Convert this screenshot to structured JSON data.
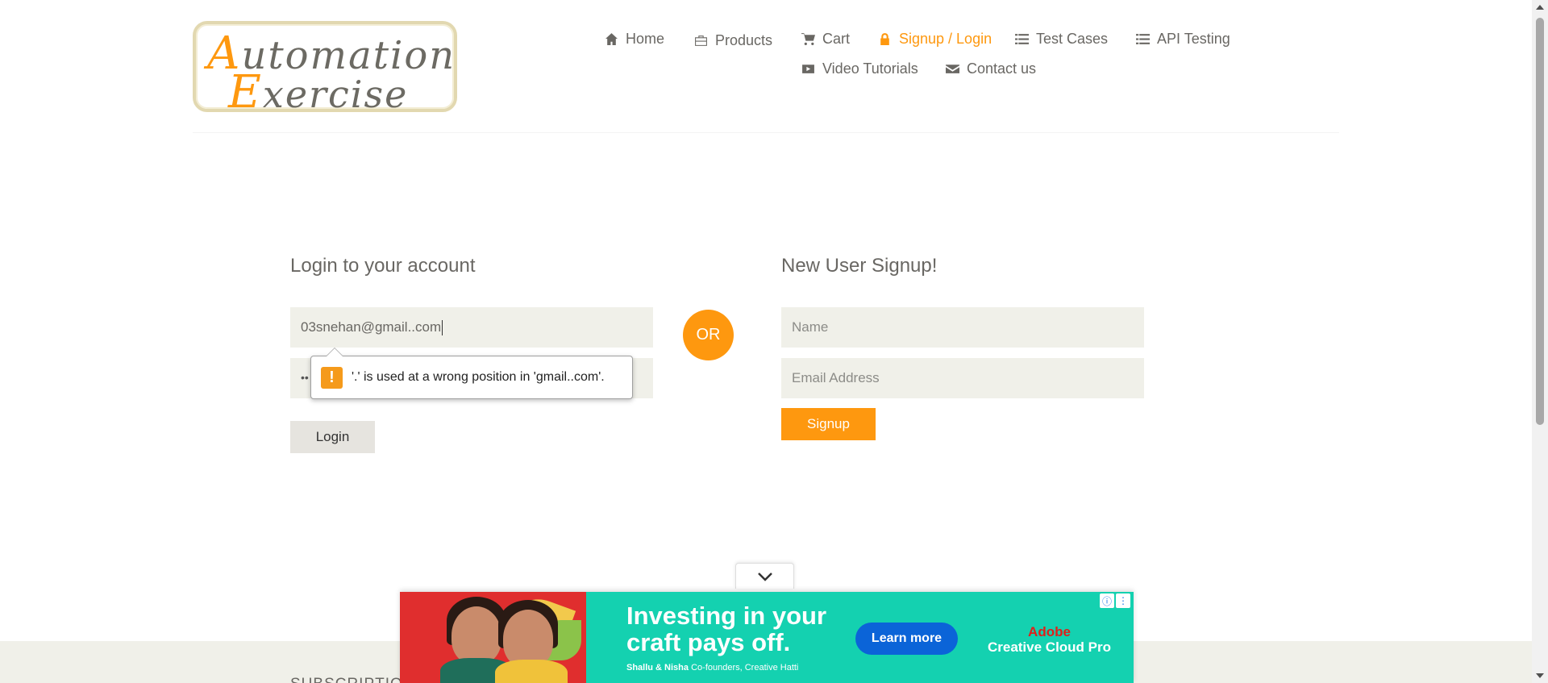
{
  "logo": {
    "line1_cap": "A",
    "line1_rest": "utomation",
    "line2_cap": "E",
    "line2_rest": "xercise"
  },
  "nav": {
    "home": "Home",
    "products": "Products",
    "cart": "Cart",
    "signup_login": "Signup / Login",
    "test_cases": "Test Cases",
    "api_testing": "API Testing",
    "video_tutorials": "Video Tutorials",
    "contact_us": "Contact us"
  },
  "login": {
    "title": "Login to your account",
    "email_value": "03snehan@gmail..com",
    "password_masked": "••",
    "button": "Login"
  },
  "validation": {
    "message": "'.' is used at a wrong position in 'gmail..com'."
  },
  "or_label": "OR",
  "signup": {
    "title": "New User Signup!",
    "name_placeholder": "Name",
    "email_placeholder": "Email Address",
    "button": "Signup"
  },
  "footer": {
    "subscription": "SUBSCRIPTION"
  },
  "ad": {
    "headline_1": "Investing in your",
    "headline_2": "craft pays off.",
    "byline_names": "Shallu & Nisha",
    "byline_role": "Co-founders, Creative Hatti",
    "cta": "Learn more",
    "brand_1": "Adobe",
    "brand_2": "Creative Cloud Pro"
  },
  "colors": {
    "accent": "#fe980f",
    "field_bg": "#f0f0e9",
    "ad_bg": "#14d1b0"
  }
}
